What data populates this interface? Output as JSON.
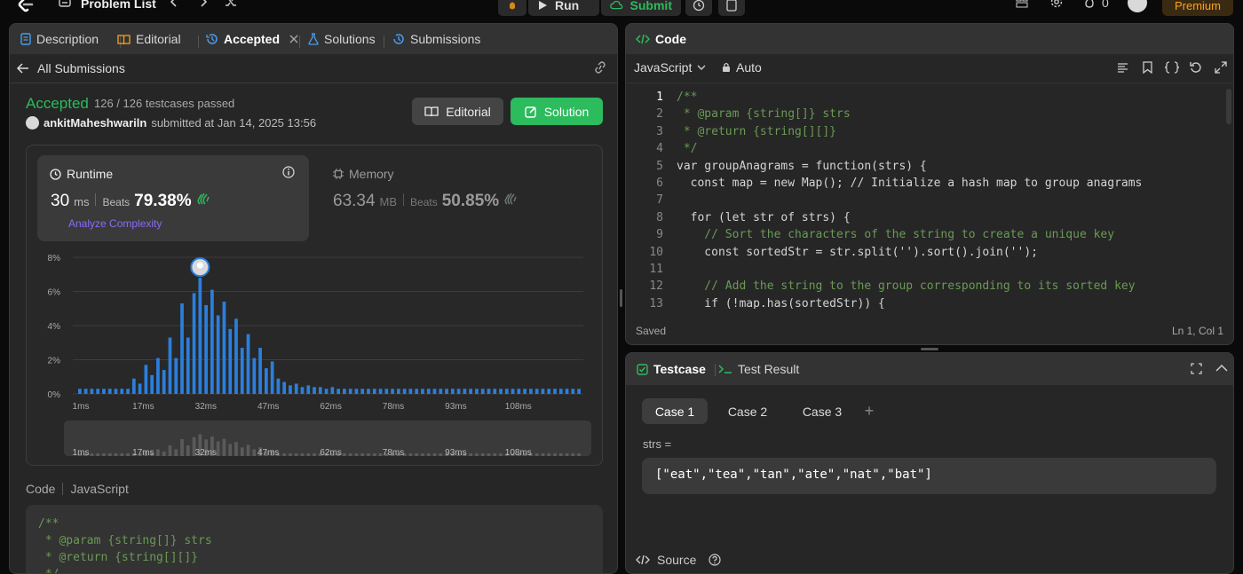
{
  "topbar": {
    "problem_list_label": "Problem List",
    "run_label": "Run",
    "submit_label": "Submit",
    "streak_count": "0",
    "premium_label": "Premium"
  },
  "left_panel": {
    "tabs": [
      {
        "label": "Description"
      },
      {
        "label": "Editorial"
      },
      {
        "label": "Accepted"
      },
      {
        "label": "Solutions"
      },
      {
        "label": "Submissions"
      }
    ],
    "back_label": "All Submissions"
  },
  "result": {
    "status": "Accepted",
    "testcases": "126 / 126 testcases passed",
    "user": "ankitMaheshwariln",
    "submitted": "submitted at Jan 14, 2025 13:56",
    "editorial_btn": "Editorial",
    "solution_btn": "Solution"
  },
  "runtime": {
    "label": "Runtime",
    "value": "30",
    "unit": "ms",
    "beats_label": "Beats",
    "beats_value": "79.38%",
    "analyze_label": "Analyze Complexity"
  },
  "memory": {
    "label": "Memory",
    "value": "63.34",
    "unit": "MB",
    "beats_label": "Beats",
    "beats_value": "50.85%"
  },
  "chart_data": {
    "type": "bar",
    "title": "",
    "xlabel": "",
    "ylabel": "",
    "ytick_labels": [
      "8%",
      "6%",
      "4%",
      "2%",
      "0%"
    ],
    "ylim": [
      0,
      8
    ],
    "xtick_labels": [
      "1ms",
      "17ms",
      "32ms",
      "47ms",
      "62ms",
      "78ms",
      "93ms",
      "108ms"
    ],
    "highlight_index": 20,
    "values": [
      0.3,
      0.3,
      0.3,
      0.3,
      0.3,
      0.3,
      0.3,
      0.3,
      0.3,
      0.9,
      0.6,
      1.7,
      1.1,
      2.1,
      1.4,
      3.3,
      2.1,
      5.3,
      3.3,
      5.9,
      6.8,
      5.2,
      6.1,
      4.6,
      5.4,
      3.8,
      4.4,
      2.7,
      3.5,
      2.1,
      2.7,
      1.5,
      1.9,
      0.9,
      0.7,
      0.5,
      0.6,
      0.4,
      0.5,
      0.4,
      0.4,
      0.3,
      0.4,
      0.3,
      0.3,
      0.3,
      0.3,
      0.3,
      0.3,
      0.3,
      0.3,
      0.3,
      0.3,
      0.3,
      0.3,
      0.3,
      0.3,
      0.3,
      0.3,
      0.3,
      0.3,
      0.3,
      0.3,
      0.3,
      0.3,
      0.3,
      0.3,
      0.3,
      0.3,
      0.3,
      0.3,
      0.3,
      0.3,
      0.3,
      0.3,
      0.3,
      0.3,
      0.3,
      0.3,
      0.3,
      0.3,
      0.3,
      0.3,
      0.3
    ],
    "grid": true,
    "color": "#2b7fdc"
  },
  "code_section": {
    "code_label": "Code",
    "lang_label": "JavaScript",
    "lines": [
      "/**",
      " * @param {string[]} strs",
      " * @return {string[][]}",
      " */"
    ]
  },
  "editor": {
    "title": "Code",
    "language": "JavaScript",
    "mode": "Auto",
    "status": "Saved",
    "cursor": "Ln 1, Col 1",
    "line_numbers": [
      "1",
      "2",
      "3",
      "4",
      "5",
      "6",
      "7",
      "8",
      "9",
      "10",
      "11",
      "12",
      "13"
    ],
    "lines": [
      "/**",
      " * @param {string[]} strs",
      " * @return {string[][]}",
      " */",
      "var groupAnagrams = function(strs) {",
      "  const map = new Map(); // Initialize a hash map to group anagrams",
      "",
      "  for (let str of strs) {",
      "    // Sort the characters of the string to create a unique key",
      "    const sortedStr = str.split('').sort().join('');",
      "",
      "    // Add the string to the group corresponding to its sorted key",
      "    if (!map.has(sortedStr)) {"
    ]
  },
  "testcase": {
    "tab_label": "Testcase",
    "result_tab_label": "Test Result",
    "cases": [
      "Case 1",
      "Case 2",
      "Case 3"
    ],
    "add_label": "+",
    "var_label": "strs =",
    "input_value": "[\"eat\",\"tea\",\"tan\",\"ate\",\"nat\",\"bat\"]",
    "source_label": "Source"
  },
  "colors": {
    "accent_green": "#2cbb5d",
    "accent_orange": "#ffa116",
    "bar_blue": "#2b7fdc",
    "analyze_purple": "#8b6bf7"
  }
}
